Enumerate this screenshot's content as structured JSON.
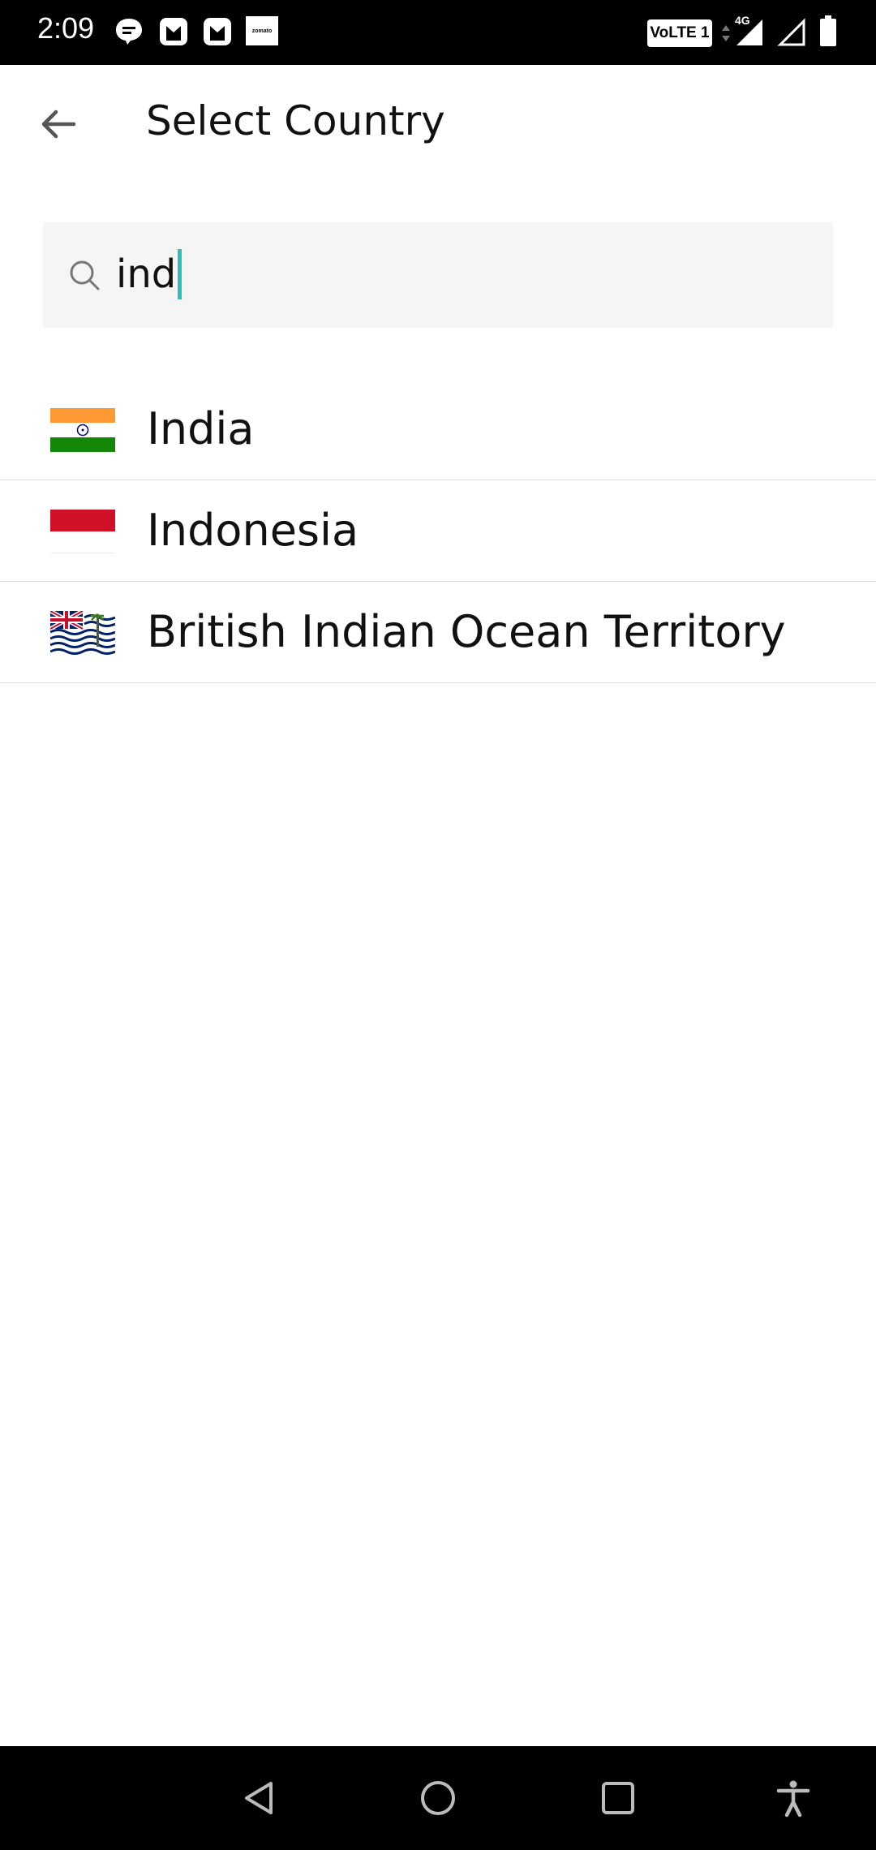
{
  "status_bar": {
    "time": "2:09",
    "notification_icons": [
      "chat-bubble-icon",
      "app-icon",
      "app-icon",
      "zomato-icon"
    ],
    "zomato_label": "zomato",
    "volte_label": "VoLTE 1",
    "network_label": "4G"
  },
  "app_bar": {
    "title": "Select Country",
    "back_icon": "arrow-left-icon"
  },
  "search": {
    "value": "ind",
    "icon": "search-icon",
    "accent_color": "#2bbfb8"
  },
  "countries": [
    {
      "name": "India",
      "flag": "flag-india-icon"
    },
    {
      "name": "Indonesia",
      "flag": "flag-indonesia-icon"
    },
    {
      "name": "British Indian Ocean Territory",
      "flag": "flag-biot-icon"
    }
  ],
  "nav_bar": {
    "buttons": [
      "back-triangle-icon",
      "home-circle-icon",
      "recents-square-icon",
      "accessibility-icon"
    ]
  }
}
